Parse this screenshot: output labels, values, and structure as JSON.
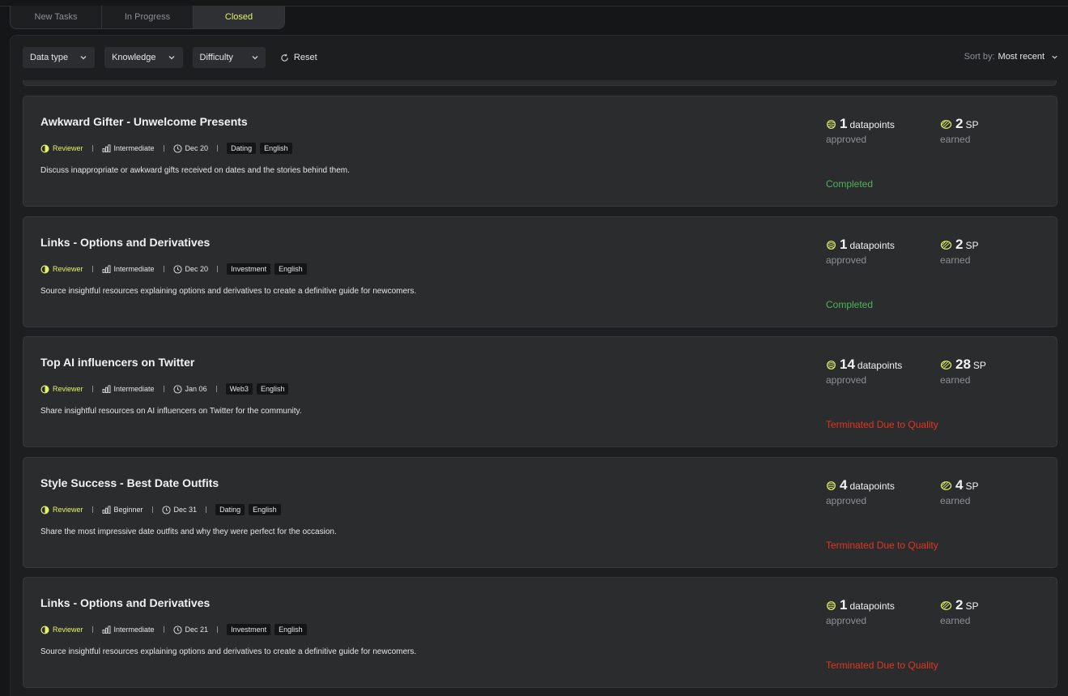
{
  "tabs": [
    {
      "label": "New Tasks",
      "active": false
    },
    {
      "label": "In Progress",
      "active": false
    },
    {
      "label": "Closed",
      "active": true
    }
  ],
  "filters": {
    "data_type": "Data type",
    "knowledge": "Knowledge",
    "difficulty": "Difficulty",
    "reset": "Reset"
  },
  "sort": {
    "label": "Sort by:",
    "value": "Most recent"
  },
  "colors": {
    "accent": "#e3f169",
    "completed": "#4fb35a",
    "terminated": "#e3361f"
  },
  "tasks": [
    {
      "title": "Awkward Gifter - Unwelcome Presents",
      "role": "Reviewer",
      "level": "Intermediate",
      "date": "Dec 20",
      "tags": [
        "Dating",
        "English"
      ],
      "description": "Discuss inappropriate or awkward gifts received on dates and the stories behind them.",
      "datapoints": "1",
      "datapoints_unit": "datapoints",
      "datapoints_label": "approved",
      "sp": "2",
      "sp_unit": "SP",
      "sp_label": "earned",
      "status": "Completed",
      "status_type": "completed"
    },
    {
      "title": "Links - Options and Derivatives",
      "role": "Reviewer",
      "level": "Intermediate",
      "date": "Dec 20",
      "tags": [
        "Investment",
        "English"
      ],
      "description": "Source insightful resources explaining options and derivatives to create a definitive guide for newcomers.",
      "datapoints": "1",
      "datapoints_unit": "datapoints",
      "datapoints_label": "approved",
      "sp": "2",
      "sp_unit": "SP",
      "sp_label": "earned",
      "status": "Completed",
      "status_type": "completed"
    },
    {
      "title": "Top AI influencers on Twitter",
      "role": "Reviewer",
      "level": "Intermediate",
      "date": "Jan 06",
      "tags": [
        "Web3",
        "English"
      ],
      "description": "Share insightful resources on AI influencers on Twitter for the community.",
      "datapoints": "14",
      "datapoints_unit": "datapoints",
      "datapoints_label": "approved",
      "sp": "28",
      "sp_unit": "SP",
      "sp_label": "earned",
      "status": "Terminated Due to Quality",
      "status_type": "terminated"
    },
    {
      "title": "Style Success - Best Date Outfits",
      "role": "Reviewer",
      "level": "Beginner",
      "date": "Dec 31",
      "tags": [
        "Dating",
        "English"
      ],
      "description": "Share the most impressive date outfits and why they were perfect for the occasion.",
      "datapoints": "4",
      "datapoints_unit": "datapoints",
      "datapoints_label": "approved",
      "sp": "4",
      "sp_unit": "SP",
      "sp_label": "earned",
      "status": "Terminated Due to Quality",
      "status_type": "terminated"
    },
    {
      "title": "Links - Options and Derivatives",
      "role": "Reviewer",
      "level": "Intermediate",
      "date": "Dec 21",
      "tags": [
        "Investment",
        "English"
      ],
      "description": "Source insightful resources explaining options and derivatives to create a definitive guide for newcomers.",
      "datapoints": "1",
      "datapoints_unit": "datapoints",
      "datapoints_label": "approved",
      "sp": "2",
      "sp_unit": "SP",
      "sp_label": "earned",
      "status": "Terminated Due to Quality",
      "status_type": "terminated"
    }
  ]
}
